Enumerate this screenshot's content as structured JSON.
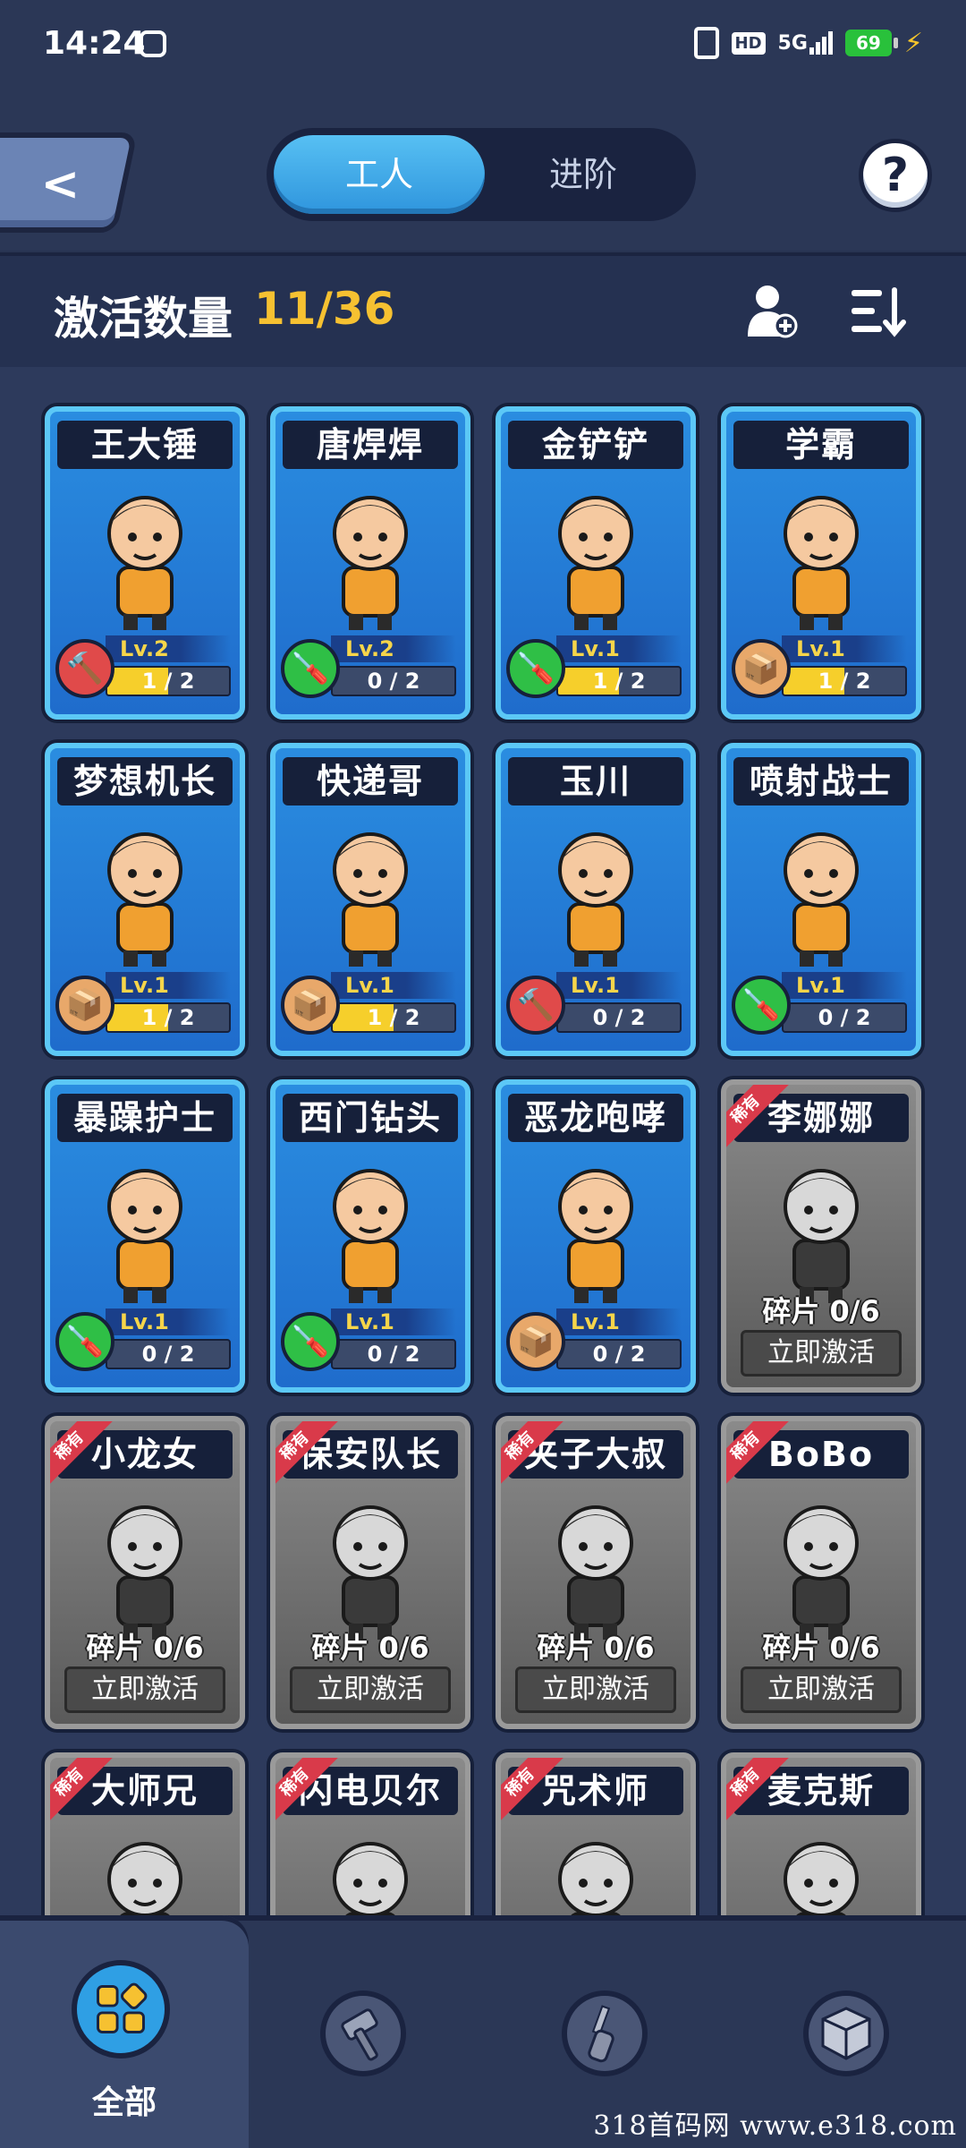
{
  "status_bar": {
    "time": "14:24",
    "network": "5G",
    "hd": "HD",
    "battery": "69"
  },
  "header": {
    "tabs": [
      {
        "label": "工人",
        "active": true
      },
      {
        "label": "进阶",
        "active": false
      }
    ],
    "help": "?"
  },
  "count": {
    "label": "激活数量",
    "value": "11/36"
  },
  "cards": [
    {
      "name": "王大锤",
      "state": "active",
      "tool": "hammer",
      "level": "Lv.2",
      "progress": "1 / 2",
      "fill": 0.5
    },
    {
      "name": "唐焊焊",
      "state": "active",
      "tool": "screwdriver",
      "level": "Lv.2",
      "progress": "0 / 2",
      "fill": 0
    },
    {
      "name": "金铲铲",
      "state": "active",
      "tool": "screwdriver",
      "level": "Lv.1",
      "progress": "1 / 2",
      "fill": 0.5
    },
    {
      "name": "学霸",
      "state": "active",
      "tool": "box",
      "level": "Lv.1",
      "progress": "1 / 2",
      "fill": 0.5
    },
    {
      "name": "梦想机长",
      "state": "active",
      "tool": "box",
      "level": "Lv.1",
      "progress": "1 / 2",
      "fill": 0.5
    },
    {
      "name": "快递哥",
      "state": "active",
      "tool": "box",
      "level": "Lv.1",
      "progress": "1 / 2",
      "fill": 0.5
    },
    {
      "name": "玉川",
      "state": "active",
      "tool": "hammer",
      "level": "Lv.1",
      "progress": "0 / 2",
      "fill": 0
    },
    {
      "name": "喷射战士",
      "state": "active",
      "tool": "screwdriver",
      "level": "Lv.1",
      "progress": "0 / 2",
      "fill": 0
    },
    {
      "name": "暴躁护士",
      "state": "active",
      "tool": "screwdriver",
      "level": "Lv.1",
      "progress": "0 / 2",
      "fill": 0
    },
    {
      "name": "西门钻头",
      "state": "active",
      "tool": "screwdriver",
      "level": "Lv.1",
      "progress": "0 / 2",
      "fill": 0
    },
    {
      "name": "恶龙咆哮",
      "state": "active",
      "tool": "box",
      "level": "Lv.1",
      "progress": "0 / 2",
      "fill": 0
    },
    {
      "name": "李娜娜",
      "state": "locked",
      "rarity": "稀有",
      "fragments": "碎片 0/6",
      "action": "立即激活"
    },
    {
      "name": "小龙女",
      "state": "locked",
      "rarity": "稀有",
      "fragments": "碎片 0/6",
      "action": "立即激活"
    },
    {
      "name": "保安队长",
      "state": "locked",
      "rarity": "稀有",
      "fragments": "碎片 0/6",
      "action": "立即激活"
    },
    {
      "name": "夹子大叔",
      "state": "locked",
      "rarity": "稀有",
      "fragments": "碎片 0/6",
      "action": "立即激活"
    },
    {
      "name": "BoBo",
      "state": "locked",
      "rarity": "稀有",
      "fragments": "碎片 0/6",
      "action": "立即激活"
    },
    {
      "name": "大师兄",
      "state": "locked",
      "rarity": "稀有",
      "fragments": "",
      "action": ""
    },
    {
      "name": "闪电贝尔",
      "state": "locked",
      "rarity": "稀有",
      "fragments": "",
      "action": ""
    },
    {
      "name": "咒术师",
      "state": "locked",
      "rarity": "稀有",
      "fragments": "",
      "action": ""
    },
    {
      "name": "麦克斯",
      "state": "locked",
      "rarity": "稀有",
      "fragments": "",
      "action": ""
    }
  ],
  "bottom_nav": {
    "items": [
      {
        "label": "全部",
        "icon": "grid-apps-icon",
        "active": true
      },
      {
        "label": "",
        "icon": "hammer-icon",
        "active": false
      },
      {
        "label": "",
        "icon": "screwdriver-icon",
        "active": false
      },
      {
        "label": "",
        "icon": "box-icon",
        "active": false
      }
    ]
  },
  "watermark": "318首码网  www.e318.com",
  "colors": {
    "accent": "#f6c131",
    "active_card": "#2a8de0",
    "tab_active": "#3aa8ea"
  }
}
